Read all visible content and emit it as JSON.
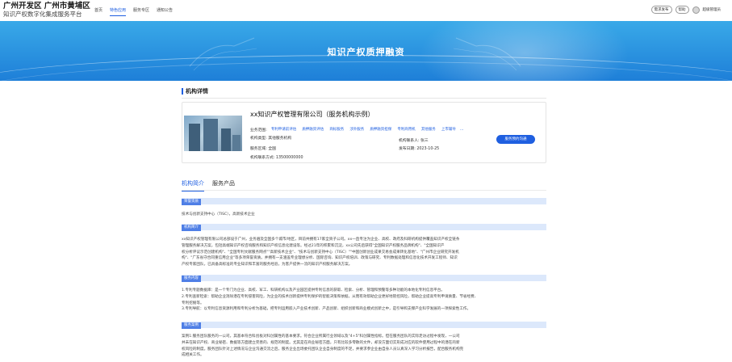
{
  "header": {
    "title": "广州开发区 广州市黄埔区",
    "subtitle": "知识产权数字化集成服务平台",
    "nav": [
      {
        "label": "首页",
        "active": false
      },
      {
        "label": "特色应用",
        "active": true
      },
      {
        "label": "服务专区",
        "active": false
      },
      {
        "label": "通知公告",
        "active": false
      }
    ],
    "btn_demand": "需求发布",
    "btn_help": "帮助",
    "user": "超级管理员"
  },
  "banner": {
    "title": "知识产权质押融资"
  },
  "section": {
    "title": "机构详情"
  },
  "org": {
    "name": "xx知识产权管理有限公司（服务机构示例）",
    "tags_label": "业务范围:",
    "tags": [
      "专利申请前评估",
      "质押融资评估",
      "商标服务",
      "涉外服务",
      "质押融资担保",
      "专利商用机",
      "其他服务",
      "上市辅导"
    ],
    "tags_more": "...",
    "type": "机构类型: 其他服务机构",
    "area": "服务区域: 全国",
    "phone": "机构联系方式: 13500000000",
    "contact": "机构联系人: 张三",
    "date": "发布日期: 2023-10-25",
    "apply": "服务预约沟通"
  },
  "tabs": [
    {
      "label": "机构简介",
      "active": true
    },
    {
      "label": "服务产品",
      "active": false
    }
  ],
  "blocks": [
    {
      "head": "荣誉资质",
      "lines": [
        "技术与创新支持中心（TISC），高新技术企业"
      ]
    },
    {
      "head": "机构简介",
      "lines": [
        "xx知识产权管理有限公司总部设于广州，业务遍及全国多个城市/地区，目前共拥有17家全资子公司。xx一直专注为企业、高校、政府及科研机构提供覆盖知识产权全链条",
        "管理服务解决方案，包括高端知识产权咨询服务和知识产权信息化建设等。经过21年的积累和沉淀，xx公司先后获得\"全国知识产权服务品牌机构\"、\"全国知识产",
        "权分析评议示范创建机构\"、\"全国专利文献服务网点\"\"高新技术企业\"、\"技术与创新支持中心（TISC）\"\"中国创新创业成果交易会成果转化基地\"、\"广州市企业研究开发机",
        "构\"、\"广东省守合同重信用企业\"等多项荣誉资质。并拥有一支涵盖专业理想分析、国际咨询、知识产权培训、政策与研究、专利数据处理和信息化技术开发工程师、知识",
        "产权专家团队，已具备高标准的专业知识和丰富的服务经验，为客户提供一流的知识产权服务解决方案。"
      ]
    },
    {
      "head": "服务内容",
      "lines": [
        "1.专利专题数据库：是一个专门为企业、高校、军工、科研机构以及产业园区提供专利信息的获取、检索、分析、管理和预警等多种功能的本地化专利信息平台。",
        "2.专利查新检索：帮助企业消除潜在专利侵害风险，为企业的技术创新提供专利保护的智能决策和依据，从而有效帮助企业更好地管控风险，帮助企业提高专利申请质量、节省经费、",
        "专利挖掘等。",
        "3.专利导航：以专利信息资源利用和专利分析为基础，把专利运用嵌入产业技术创新、产品创新、组织创新和商业模式创新之中，是引导和支撑产业科学发展的一项探索性工作。"
      ]
    },
    {
      "head": "服务案例",
      "lines": [
        "案例1:服务团队服务的一公司，其基本符合科创板对科创属性的基本要求。符合企业所属行业领域以及\"4+5\"科创属性指标。但在服务团队的实际走访过程中发现，一公司",
        "并未在知识产权、商业秘密、数据等方面建立完善的、规范的制度。尤其是在商业秘密方面，只有比较多零散的文件，却没方面切实形成对应的软件使用过程中的潜在的新",
        "权风险的制度。服务团队针对上述情况与企业沟通交流之后，服务企业出场委托团队企业自身制度的不足，并要求参企业由自身人员认真深入学习分析报告，配合服务机构完",
        "成相关工作。"
      ]
    }
  ]
}
